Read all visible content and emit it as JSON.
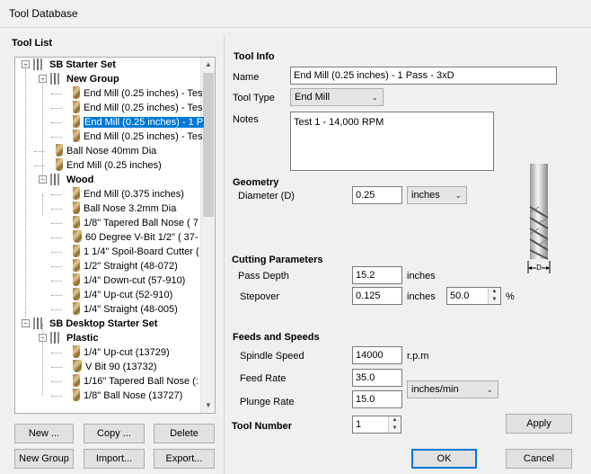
{
  "window": {
    "title": "Tool Database"
  },
  "tool_list": {
    "label": "Tool List",
    "rows": [
      {
        "text": "SB Starter Set",
        "bold": true,
        "kind": "group"
      },
      {
        "text": "New Group",
        "bold": true,
        "kind": "group"
      },
      {
        "text": "End Mill (0.25 inches) - Tes",
        "kind": "tool"
      },
      {
        "text": "End Mill (0.25 inches) - Tes",
        "kind": "tool"
      },
      {
        "text": "End Mill (0.25 inches) - 1 P",
        "kind": "tool",
        "selected": true
      },
      {
        "text": "End Mill (0.25 inches) - Tes",
        "kind": "tool"
      },
      {
        "text": "Ball Nose 40mm Dia",
        "kind": "tool"
      },
      {
        "text": "End Mill (0.25 inches)",
        "kind": "tool"
      },
      {
        "text": "Wood",
        "bold": true,
        "kind": "group"
      },
      {
        "text": "End Mill (0.375 inches)",
        "kind": "tool"
      },
      {
        "text": "Ball Nose 3.2mm Dia",
        "kind": "tool"
      },
      {
        "text": "1/8\" Tapered Ball Nose  ( 7",
        "kind": "tool"
      },
      {
        "text": "60 Degree V-Bit 1/2\"  ( 37-",
        "kind": "vbit"
      },
      {
        "text": "1 1/4\" Spoil-Board Cutter (",
        "kind": "tool"
      },
      {
        "text": "1/2\" Straight  (48-072)",
        "kind": "tool"
      },
      {
        "text": "1/4\"  Down-cut (57-910)",
        "kind": "tool"
      },
      {
        "text": "1/4\" Up-cut (52-910)",
        "kind": "tool"
      },
      {
        "text": "1/4\" Straight  (48-005)",
        "kind": "tool"
      },
      {
        "text": "SB Desktop Starter Set",
        "bold": true,
        "kind": "group"
      },
      {
        "text": "Plastic",
        "bold": true,
        "kind": "group"
      },
      {
        "text": "1/4\" Up-cut (13729)",
        "kind": "tool"
      },
      {
        "text": "V Bit 90 (13732)",
        "kind": "vbit"
      },
      {
        "text": "1/16\" Tapered Ball Nose (:",
        "kind": "tool"
      },
      {
        "text": "1/8\" Ball Nose (13727)",
        "kind": "tool"
      }
    ]
  },
  "buttons": {
    "new": "New ...",
    "copy": "Copy ...",
    "delete": "Delete",
    "new_group": "New Group",
    "import": "Import...",
    "export": "Export...",
    "apply": "Apply",
    "ok": "OK",
    "cancel": "Cancel"
  },
  "tool_info": {
    "section": "Tool Info",
    "name_label": "Name",
    "name_value": "End Mill (0.25 inches) - 1 Pass - 3xD",
    "type_label": "Tool Type",
    "type_value": "End Mill",
    "notes_label": "Notes",
    "notes_value": "Test 1 - 14,000 RPM"
  },
  "geometry": {
    "section": "Geometry",
    "diameter_label": "Diameter (D)",
    "diameter_value": "0.25",
    "units_value": "inches",
    "preview_label": "D"
  },
  "cutting": {
    "section": "Cutting Parameters",
    "pass_depth_label": "Pass Depth",
    "pass_depth_value": "15.2",
    "pass_depth_unit": "inches",
    "stepover_label": "Stepover",
    "stepover_value": "0.125",
    "stepover_unit": "inches",
    "stepover_percent": "50.0",
    "percent_sign": "%"
  },
  "feeds": {
    "section": "Feeds and Speeds",
    "spindle_label": "Spindle Speed",
    "spindle_value": "14000",
    "spindle_unit": "r.p.m",
    "feed_label": "Feed Rate",
    "feed_value": "35.0",
    "plunge_label": "Plunge Rate",
    "plunge_value": "15.0",
    "rate_units": "inches/min"
  },
  "tool_number": {
    "label": "Tool Number",
    "value": "1"
  }
}
